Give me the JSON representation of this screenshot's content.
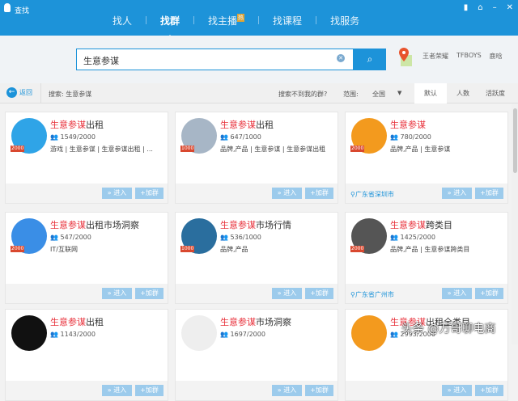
{
  "window": {
    "title": "查找",
    "controls": [
      "▮",
      "⌂",
      "–",
      "✕"
    ]
  },
  "tabs": [
    {
      "label": "找人"
    },
    {
      "label": "找群",
      "active": true
    },
    {
      "label": "找主播",
      "badge": "热"
    },
    {
      "label": "找课程"
    },
    {
      "label": "找服务"
    }
  ],
  "search": {
    "value": "生意参谋",
    "hot": [
      "王者荣耀",
      "TFBOYS",
      "鹿晗"
    ]
  },
  "filter": {
    "back": "返回",
    "searched": "搜索: 生意参谋",
    "not_found": "搜索不到我的群?",
    "range_label": "范围:",
    "range_value": "全国",
    "sorts": [
      "默认",
      "人数",
      "活跃度"
    ]
  },
  "buttons": {
    "enter": "» 进入",
    "join": "+加群"
  },
  "cards": [
    {
      "hl": "生意参谋",
      "rest": "出租",
      "count": "1549/2000",
      "tags": "游戏 | 生意参谋 | 生意参谋出租 | ...",
      "cap": "2000",
      "loc": "",
      "color": "#2fa4e7"
    },
    {
      "hl": "生意参谋",
      "rest": "出租",
      "count": "647/1000",
      "tags": "品牌,产品 | 生意参谋 | 生意参谋出租",
      "cap": "1000",
      "loc": "",
      "color": "#a7b6c6"
    },
    {
      "hl": "生意参谋",
      "rest": "",
      "count": "780/2000",
      "tags": "品牌,产品 | 生意参谋",
      "cap": "2000",
      "loc": "广东省深圳市",
      "color": "#f39a1e"
    },
    {
      "hl": "生意参谋",
      "rest": "出租市场洞察",
      "count": "547/2000",
      "tags": "IT/互联网",
      "cap": "2000",
      "loc": "",
      "color": "#3a8ee6"
    },
    {
      "hl": "生意参谋",
      "rest": "市场行情",
      "count": "536/1000",
      "tags": "品牌,产品",
      "cap": "1000",
      "loc": "",
      "color": "#2a6e9e"
    },
    {
      "hl": "生意参谋",
      "rest": "跨类目",
      "count": "1425/2000",
      "tags": "品牌,产品 | 生意参谋跨类目",
      "cap": "2000",
      "loc": "广东省广州市",
      "color": "#555"
    },
    {
      "hl": "生意参谋",
      "rest": "出租",
      "count": "1143/2000",
      "tags": "",
      "cap": "",
      "loc": "",
      "color": "#111"
    },
    {
      "hl": "生意参谋",
      "rest": "市场洞察",
      "count": "1697/2000",
      "tags": "",
      "cap": "",
      "loc": "",
      "color": "#eee"
    },
    {
      "hl": "生意参谋",
      "rest": "出租全类目",
      "count": "2993/2000",
      "tags": "",
      "cap": "",
      "loc": "",
      "color": "#f39a1e"
    }
  ],
  "watermark": "头条 @万哥聊电商"
}
